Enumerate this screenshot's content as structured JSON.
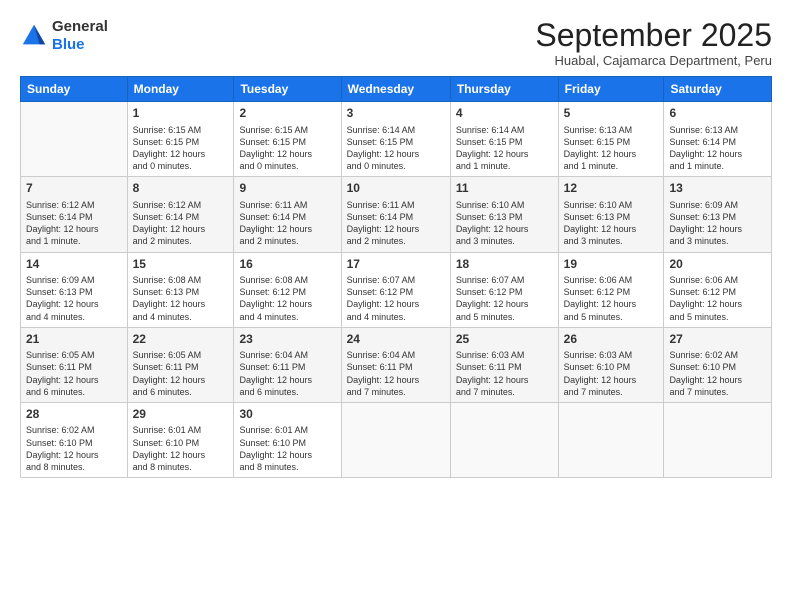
{
  "logo": {
    "general": "General",
    "blue": "Blue"
  },
  "title": "September 2025",
  "subtitle": "Huabal, Cajamarca Department, Peru",
  "days_of_week": [
    "Sunday",
    "Monday",
    "Tuesday",
    "Wednesday",
    "Thursday",
    "Friday",
    "Saturday"
  ],
  "weeks": [
    [
      {
        "day": "",
        "info": ""
      },
      {
        "day": "1",
        "info": "Sunrise: 6:15 AM\nSunset: 6:15 PM\nDaylight: 12 hours\nand 0 minutes."
      },
      {
        "day": "2",
        "info": "Sunrise: 6:15 AM\nSunset: 6:15 PM\nDaylight: 12 hours\nand 0 minutes."
      },
      {
        "day": "3",
        "info": "Sunrise: 6:14 AM\nSunset: 6:15 PM\nDaylight: 12 hours\nand 0 minutes."
      },
      {
        "day": "4",
        "info": "Sunrise: 6:14 AM\nSunset: 6:15 PM\nDaylight: 12 hours\nand 1 minute."
      },
      {
        "day": "5",
        "info": "Sunrise: 6:13 AM\nSunset: 6:15 PM\nDaylight: 12 hours\nand 1 minute."
      },
      {
        "day": "6",
        "info": "Sunrise: 6:13 AM\nSunset: 6:14 PM\nDaylight: 12 hours\nand 1 minute."
      }
    ],
    [
      {
        "day": "7",
        "info": "Sunrise: 6:12 AM\nSunset: 6:14 PM\nDaylight: 12 hours\nand 1 minute."
      },
      {
        "day": "8",
        "info": "Sunrise: 6:12 AM\nSunset: 6:14 PM\nDaylight: 12 hours\nand 2 minutes."
      },
      {
        "day": "9",
        "info": "Sunrise: 6:11 AM\nSunset: 6:14 PM\nDaylight: 12 hours\nand 2 minutes."
      },
      {
        "day": "10",
        "info": "Sunrise: 6:11 AM\nSunset: 6:14 PM\nDaylight: 12 hours\nand 2 minutes."
      },
      {
        "day": "11",
        "info": "Sunrise: 6:10 AM\nSunset: 6:13 PM\nDaylight: 12 hours\nand 3 minutes."
      },
      {
        "day": "12",
        "info": "Sunrise: 6:10 AM\nSunset: 6:13 PM\nDaylight: 12 hours\nand 3 minutes."
      },
      {
        "day": "13",
        "info": "Sunrise: 6:09 AM\nSunset: 6:13 PM\nDaylight: 12 hours\nand 3 minutes."
      }
    ],
    [
      {
        "day": "14",
        "info": "Sunrise: 6:09 AM\nSunset: 6:13 PM\nDaylight: 12 hours\nand 4 minutes."
      },
      {
        "day": "15",
        "info": "Sunrise: 6:08 AM\nSunset: 6:13 PM\nDaylight: 12 hours\nand 4 minutes."
      },
      {
        "day": "16",
        "info": "Sunrise: 6:08 AM\nSunset: 6:12 PM\nDaylight: 12 hours\nand 4 minutes."
      },
      {
        "day": "17",
        "info": "Sunrise: 6:07 AM\nSunset: 6:12 PM\nDaylight: 12 hours\nand 4 minutes."
      },
      {
        "day": "18",
        "info": "Sunrise: 6:07 AM\nSunset: 6:12 PM\nDaylight: 12 hours\nand 5 minutes."
      },
      {
        "day": "19",
        "info": "Sunrise: 6:06 AM\nSunset: 6:12 PM\nDaylight: 12 hours\nand 5 minutes."
      },
      {
        "day": "20",
        "info": "Sunrise: 6:06 AM\nSunset: 6:12 PM\nDaylight: 12 hours\nand 5 minutes."
      }
    ],
    [
      {
        "day": "21",
        "info": "Sunrise: 6:05 AM\nSunset: 6:11 PM\nDaylight: 12 hours\nand 6 minutes."
      },
      {
        "day": "22",
        "info": "Sunrise: 6:05 AM\nSunset: 6:11 PM\nDaylight: 12 hours\nand 6 minutes."
      },
      {
        "day": "23",
        "info": "Sunrise: 6:04 AM\nSunset: 6:11 PM\nDaylight: 12 hours\nand 6 minutes."
      },
      {
        "day": "24",
        "info": "Sunrise: 6:04 AM\nSunset: 6:11 PM\nDaylight: 12 hours\nand 7 minutes."
      },
      {
        "day": "25",
        "info": "Sunrise: 6:03 AM\nSunset: 6:11 PM\nDaylight: 12 hours\nand 7 minutes."
      },
      {
        "day": "26",
        "info": "Sunrise: 6:03 AM\nSunset: 6:10 PM\nDaylight: 12 hours\nand 7 minutes."
      },
      {
        "day": "27",
        "info": "Sunrise: 6:02 AM\nSunset: 6:10 PM\nDaylight: 12 hours\nand 7 minutes."
      }
    ],
    [
      {
        "day": "28",
        "info": "Sunrise: 6:02 AM\nSunset: 6:10 PM\nDaylight: 12 hours\nand 8 minutes."
      },
      {
        "day": "29",
        "info": "Sunrise: 6:01 AM\nSunset: 6:10 PM\nDaylight: 12 hours\nand 8 minutes."
      },
      {
        "day": "30",
        "info": "Sunrise: 6:01 AM\nSunset: 6:10 PM\nDaylight: 12 hours\nand 8 minutes."
      },
      {
        "day": "",
        "info": ""
      },
      {
        "day": "",
        "info": ""
      },
      {
        "day": "",
        "info": ""
      },
      {
        "day": "",
        "info": ""
      }
    ]
  ]
}
